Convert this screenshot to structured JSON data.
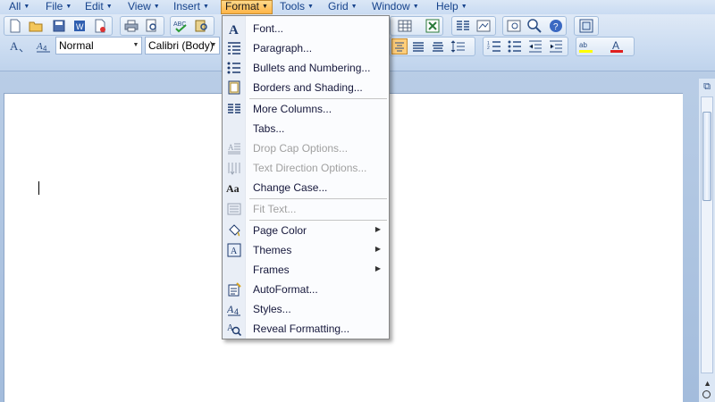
{
  "menubar": {
    "items": [
      {
        "label": "All"
      },
      {
        "label": "File"
      },
      {
        "label": "Edit"
      },
      {
        "label": "View"
      },
      {
        "label": "Insert"
      },
      {
        "label": "Format"
      },
      {
        "label": "Tools"
      },
      {
        "label": "Grid"
      },
      {
        "label": "Window"
      },
      {
        "label": "Help"
      }
    ],
    "active": "Format"
  },
  "ribbon": {
    "style_value": "Normal",
    "font_value": "Calibri (Body)"
  },
  "format_menu": {
    "items": [
      {
        "label": "Font...",
        "icon": "font-icon",
        "enabled": true
      },
      {
        "label": "Paragraph...",
        "icon": "paragraph-icon",
        "enabled": true
      },
      {
        "label": "Bullets and Numbering...",
        "icon": "bullets-icon",
        "enabled": true
      },
      {
        "label": "Borders and Shading...",
        "icon": "borders-icon",
        "enabled": true
      },
      {
        "label": "More Columns...",
        "icon": "columns-icon",
        "enabled": true
      },
      {
        "label": "Tabs...",
        "icon": "",
        "enabled": true
      },
      {
        "label": "Drop Cap Options...",
        "icon": "drop-cap-icon",
        "enabled": false
      },
      {
        "label": "Text Direction Options...",
        "icon": "text-direction-icon",
        "enabled": false
      },
      {
        "label": "Change Case...",
        "icon": "change-case-icon",
        "enabled": true
      },
      {
        "label": "Fit Text...",
        "icon": "fit-text-icon",
        "enabled": false
      },
      {
        "label": "Page Color",
        "icon": "page-color-icon",
        "enabled": true,
        "submenu": true
      },
      {
        "label": "Themes",
        "icon": "themes-icon",
        "enabled": true,
        "submenu": true
      },
      {
        "label": "Frames",
        "icon": "",
        "enabled": true,
        "submenu": true
      },
      {
        "label": "AutoFormat...",
        "icon": "autoformat-icon",
        "enabled": true
      },
      {
        "label": "Styles...",
        "icon": "styles-icon",
        "enabled": true
      },
      {
        "label": "Reveal Formatting...",
        "icon": "reveal-formatting-icon",
        "enabled": true
      }
    ]
  },
  "colors": {
    "accent": "#ffb447",
    "menu_text": "#15173b",
    "disabled_text": "#a0a0a0"
  }
}
